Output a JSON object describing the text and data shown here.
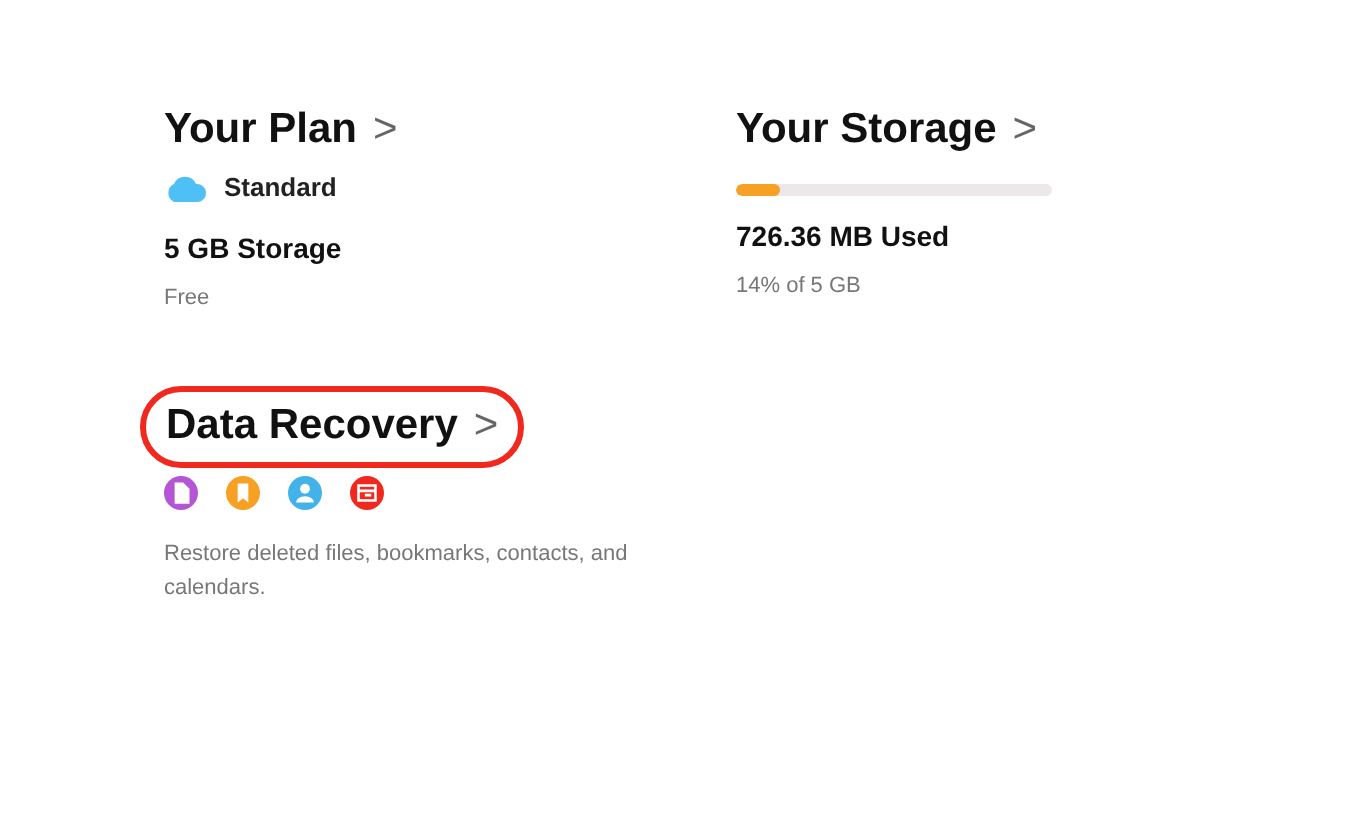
{
  "plan": {
    "title": "Your Plan",
    "chevron": ">",
    "tier": "Standard",
    "storage": "5 GB Storage",
    "price": "Free"
  },
  "storage": {
    "title": "Your Storage",
    "chevron": ">",
    "level": 0.14,
    "used": "726.36 MB Used",
    "share": "14% of 5 GB"
  },
  "recovery": {
    "title": "Data Recovery",
    "chevron": ">",
    "highlighted": true,
    "icons": [
      {
        "kind": "file",
        "color": "#b455d6"
      },
      {
        "kind": "bookmark",
        "color": "#f7a023"
      },
      {
        "kind": "contact",
        "color": "#41b3e8"
      },
      {
        "kind": "calendar",
        "color": "#f0281e"
      }
    ],
    "description": "Restore deleted files, bookmarks, contacts, and calendars."
  }
}
